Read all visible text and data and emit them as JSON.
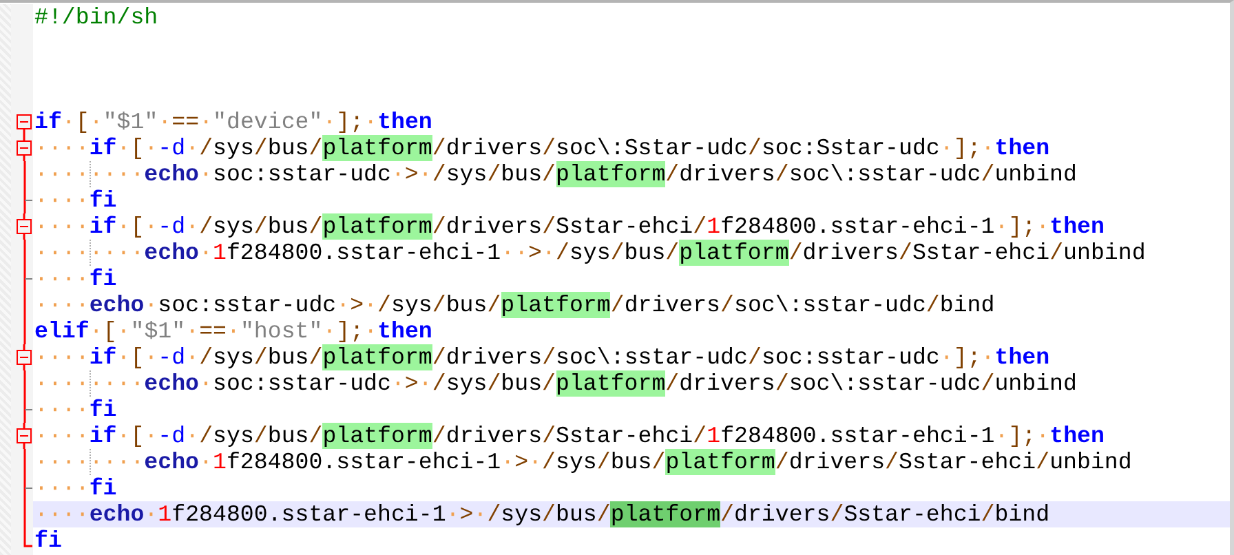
{
  "editor": {
    "lines": [
      {
        "fold_start": false,
        "fold_end": false,
        "active_fold": false,
        "current": false,
        "guide": false,
        "tokens": [
          {
            "kind": "comment",
            "text": "#!/bin/sh"
          }
        ]
      },
      {
        "fold_start": false,
        "fold_end": false,
        "active_fold": false,
        "current": false,
        "guide": false
      },
      {
        "fold_start": false,
        "fold_end": false,
        "active_fold": false,
        "current": false,
        "guide": false
      },
      {
        "fold_start": false,
        "fold_end": false,
        "active_fold": false,
        "current": false,
        "guide": false
      },
      {
        "fold_start": true,
        "fold_end": false,
        "active_fold": true,
        "current": false,
        "guide": false,
        "tokens": [
          {
            "kind": "keyword",
            "text": "if"
          },
          {
            "kind": "space",
            "text": "·"
          },
          {
            "kind": "operator",
            "text": "["
          },
          {
            "kind": "space",
            "text": "·"
          },
          {
            "kind": "string",
            "text": "\"$1\""
          },
          {
            "kind": "space",
            "text": "·"
          },
          {
            "kind": "operator",
            "text": "=="
          },
          {
            "kind": "space",
            "text": "·"
          },
          {
            "kind": "string",
            "text": "\"device\""
          },
          {
            "kind": "space",
            "text": "·"
          },
          {
            "kind": "operator",
            "text": "];"
          },
          {
            "kind": "space",
            "text": "·"
          },
          {
            "kind": "keyword",
            "text": "then"
          }
        ]
      },
      {
        "fold_start": true,
        "fold_end": false,
        "active_fold": true,
        "current": false,
        "guide": false,
        "tokens": [
          {
            "kind": "space",
            "text": "····"
          },
          {
            "kind": "keyword",
            "text": "if"
          },
          {
            "kind": "space",
            "text": "·"
          },
          {
            "kind": "operator",
            "text": "["
          },
          {
            "kind": "space",
            "text": "·"
          },
          {
            "kind": "option",
            "text": "-d"
          },
          {
            "kind": "space",
            "text": "·"
          },
          {
            "kind": "operator",
            "text": "/"
          },
          {
            "kind": "plain",
            "text": "sys"
          },
          {
            "kind": "operator",
            "text": "/"
          },
          {
            "kind": "plain",
            "text": "bus"
          },
          {
            "kind": "operator",
            "text": "/"
          },
          {
            "kind": "match",
            "text": "platform"
          },
          {
            "kind": "operator",
            "text": "/"
          },
          {
            "kind": "plain",
            "text": "drivers"
          },
          {
            "kind": "operator",
            "text": "/"
          },
          {
            "kind": "plain",
            "text": "soc\\:Sstar-udc"
          },
          {
            "kind": "operator",
            "text": "/"
          },
          {
            "kind": "plain",
            "text": "soc:Sstar-udc"
          },
          {
            "kind": "space",
            "text": "·"
          },
          {
            "kind": "operator",
            "text": "];"
          },
          {
            "kind": "space",
            "text": "·"
          },
          {
            "kind": "keyword",
            "text": "then"
          }
        ]
      },
      {
        "fold_start": false,
        "fold_end": false,
        "active_fold": true,
        "current": false,
        "guide": true,
        "tokens": [
          {
            "kind": "space",
            "text": "········"
          },
          {
            "kind": "builtin",
            "text": "echo"
          },
          {
            "kind": "space",
            "text": "·"
          },
          {
            "kind": "plain",
            "text": "soc:sstar-udc"
          },
          {
            "kind": "space",
            "text": "·"
          },
          {
            "kind": "operator",
            "text": ">"
          },
          {
            "kind": "space",
            "text": "·"
          },
          {
            "kind": "operator",
            "text": "/"
          },
          {
            "kind": "plain",
            "text": "sys"
          },
          {
            "kind": "operator",
            "text": "/"
          },
          {
            "kind": "plain",
            "text": "bus"
          },
          {
            "kind": "operator",
            "text": "/"
          },
          {
            "kind": "match",
            "text": "platform"
          },
          {
            "kind": "operator",
            "text": "/"
          },
          {
            "kind": "plain",
            "text": "drivers"
          },
          {
            "kind": "operator",
            "text": "/"
          },
          {
            "kind": "plain",
            "text": "soc\\:sstar-udc"
          },
          {
            "kind": "operator",
            "text": "/"
          },
          {
            "kind": "plain",
            "text": "unbind"
          }
        ]
      },
      {
        "fold_start": false,
        "fold_end": true,
        "active_fold": true,
        "current": false,
        "guide": false,
        "tokens": [
          {
            "kind": "space",
            "text": "····"
          },
          {
            "kind": "keyword",
            "text": "fi"
          }
        ]
      },
      {
        "fold_start": true,
        "fold_end": false,
        "active_fold": true,
        "current": false,
        "guide": false,
        "tokens": [
          {
            "kind": "space",
            "text": "····"
          },
          {
            "kind": "keyword",
            "text": "if"
          },
          {
            "kind": "space",
            "text": "·"
          },
          {
            "kind": "operator",
            "text": "["
          },
          {
            "kind": "space",
            "text": "·"
          },
          {
            "kind": "option",
            "text": "-d"
          },
          {
            "kind": "space",
            "text": "·"
          },
          {
            "kind": "operator",
            "text": "/"
          },
          {
            "kind": "plain",
            "text": "sys"
          },
          {
            "kind": "operator",
            "text": "/"
          },
          {
            "kind": "plain",
            "text": "bus"
          },
          {
            "kind": "operator",
            "text": "/"
          },
          {
            "kind": "match",
            "text": "platform"
          },
          {
            "kind": "operator",
            "text": "/"
          },
          {
            "kind": "plain",
            "text": "drivers"
          },
          {
            "kind": "operator",
            "text": "/"
          },
          {
            "kind": "plain",
            "text": "Sstar-ehci"
          },
          {
            "kind": "operator",
            "text": "/"
          },
          {
            "kind": "number",
            "text": "1"
          },
          {
            "kind": "plain",
            "text": "f284800.sstar-ehci-1"
          },
          {
            "kind": "space",
            "text": "·"
          },
          {
            "kind": "operator",
            "text": "];"
          },
          {
            "kind": "space",
            "text": "·"
          },
          {
            "kind": "keyword",
            "text": "then"
          }
        ]
      },
      {
        "fold_start": false,
        "fold_end": false,
        "active_fold": true,
        "current": false,
        "guide": true,
        "tokens": [
          {
            "kind": "space",
            "text": "········"
          },
          {
            "kind": "builtin",
            "text": "echo"
          },
          {
            "kind": "space",
            "text": "·"
          },
          {
            "kind": "number",
            "text": "1"
          },
          {
            "kind": "plain",
            "text": "f284800.sstar-ehci-1"
          },
          {
            "kind": "space",
            "text": "··"
          },
          {
            "kind": "operator",
            "text": ">"
          },
          {
            "kind": "space",
            "text": "·"
          },
          {
            "kind": "operator",
            "text": "/"
          },
          {
            "kind": "plain",
            "text": "sys"
          },
          {
            "kind": "operator",
            "text": "/"
          },
          {
            "kind": "plain",
            "text": "bus"
          },
          {
            "kind": "operator",
            "text": "/"
          },
          {
            "kind": "match",
            "text": "platform"
          },
          {
            "kind": "operator",
            "text": "/"
          },
          {
            "kind": "plain",
            "text": "drivers"
          },
          {
            "kind": "operator",
            "text": "/"
          },
          {
            "kind": "plain",
            "text": "Sstar-ehci"
          },
          {
            "kind": "operator",
            "text": "/"
          },
          {
            "kind": "plain",
            "text": "unbind"
          }
        ]
      },
      {
        "fold_start": false,
        "fold_end": true,
        "active_fold": true,
        "current": false,
        "guide": false,
        "tokens": [
          {
            "kind": "space",
            "text": "····"
          },
          {
            "kind": "keyword",
            "text": "fi"
          }
        ]
      },
      {
        "fold_start": false,
        "fold_end": false,
        "active_fold": true,
        "current": false,
        "guide": false,
        "tokens": [
          {
            "kind": "space",
            "text": "····"
          },
          {
            "kind": "builtin",
            "text": "echo"
          },
          {
            "kind": "space",
            "text": "·"
          },
          {
            "kind": "plain",
            "text": "soc:sstar-udc"
          },
          {
            "kind": "space",
            "text": "·"
          },
          {
            "kind": "operator",
            "text": ">"
          },
          {
            "kind": "space",
            "text": "·"
          },
          {
            "kind": "operator",
            "text": "/"
          },
          {
            "kind": "plain",
            "text": "sys"
          },
          {
            "kind": "operator",
            "text": "/"
          },
          {
            "kind": "plain",
            "text": "bus"
          },
          {
            "kind": "operator",
            "text": "/"
          },
          {
            "kind": "match",
            "text": "platform"
          },
          {
            "kind": "operator",
            "text": "/"
          },
          {
            "kind": "plain",
            "text": "drivers"
          },
          {
            "kind": "operator",
            "text": "/"
          },
          {
            "kind": "plain",
            "text": "soc\\:sstar-udc"
          },
          {
            "kind": "operator",
            "text": "/"
          },
          {
            "kind": "plain",
            "text": "bind"
          }
        ]
      },
      {
        "fold_start": false,
        "fold_end": false,
        "active_fold": true,
        "current": false,
        "guide": false,
        "tokens": [
          {
            "kind": "keyword",
            "text": "elif"
          },
          {
            "kind": "space",
            "text": "·"
          },
          {
            "kind": "operator",
            "text": "["
          },
          {
            "kind": "space",
            "text": "·"
          },
          {
            "kind": "string",
            "text": "\"$1\""
          },
          {
            "kind": "space",
            "text": "·"
          },
          {
            "kind": "operator",
            "text": "=="
          },
          {
            "kind": "space",
            "text": "·"
          },
          {
            "kind": "string",
            "text": "\"host\""
          },
          {
            "kind": "space",
            "text": "·"
          },
          {
            "kind": "operator",
            "text": "];"
          },
          {
            "kind": "space",
            "text": "·"
          },
          {
            "kind": "keyword",
            "text": "then"
          }
        ]
      },
      {
        "fold_start": true,
        "fold_end": false,
        "active_fold": true,
        "current": false,
        "guide": false,
        "tokens": [
          {
            "kind": "space",
            "text": "····"
          },
          {
            "kind": "keyword",
            "text": "if"
          },
          {
            "kind": "space",
            "text": "·"
          },
          {
            "kind": "operator",
            "text": "["
          },
          {
            "kind": "space",
            "text": "·"
          },
          {
            "kind": "option",
            "text": "-d"
          },
          {
            "kind": "space",
            "text": "·"
          },
          {
            "kind": "operator",
            "text": "/"
          },
          {
            "kind": "plain",
            "text": "sys"
          },
          {
            "kind": "operator",
            "text": "/"
          },
          {
            "kind": "plain",
            "text": "bus"
          },
          {
            "kind": "operator",
            "text": "/"
          },
          {
            "kind": "match",
            "text": "platform"
          },
          {
            "kind": "operator",
            "text": "/"
          },
          {
            "kind": "plain",
            "text": "drivers"
          },
          {
            "kind": "operator",
            "text": "/"
          },
          {
            "kind": "plain",
            "text": "soc\\:sstar-udc"
          },
          {
            "kind": "operator",
            "text": "/"
          },
          {
            "kind": "plain",
            "text": "soc:sstar-udc"
          },
          {
            "kind": "space",
            "text": "·"
          },
          {
            "kind": "operator",
            "text": "];"
          },
          {
            "kind": "space",
            "text": "·"
          },
          {
            "kind": "keyword",
            "text": "then"
          }
        ]
      },
      {
        "fold_start": false,
        "fold_end": false,
        "active_fold": true,
        "current": false,
        "guide": true,
        "tokens": [
          {
            "kind": "space",
            "text": "········"
          },
          {
            "kind": "builtin",
            "text": "echo"
          },
          {
            "kind": "space",
            "text": "·"
          },
          {
            "kind": "plain",
            "text": "soc:sstar-udc"
          },
          {
            "kind": "space",
            "text": "·"
          },
          {
            "kind": "operator",
            "text": ">"
          },
          {
            "kind": "space",
            "text": "·"
          },
          {
            "kind": "operator",
            "text": "/"
          },
          {
            "kind": "plain",
            "text": "sys"
          },
          {
            "kind": "operator",
            "text": "/"
          },
          {
            "kind": "plain",
            "text": "bus"
          },
          {
            "kind": "operator",
            "text": "/"
          },
          {
            "kind": "match",
            "text": "platform"
          },
          {
            "kind": "operator",
            "text": "/"
          },
          {
            "kind": "plain",
            "text": "drivers"
          },
          {
            "kind": "operator",
            "text": "/"
          },
          {
            "kind": "plain",
            "text": "soc\\:sstar-udc"
          },
          {
            "kind": "operator",
            "text": "/"
          },
          {
            "kind": "plain",
            "text": "unbind"
          }
        ]
      },
      {
        "fold_start": false,
        "fold_end": true,
        "active_fold": true,
        "current": false,
        "guide": false,
        "tokens": [
          {
            "kind": "space",
            "text": "····"
          },
          {
            "kind": "keyword",
            "text": "fi"
          }
        ]
      },
      {
        "fold_start": true,
        "fold_end": false,
        "active_fold": true,
        "current": false,
        "guide": false,
        "tokens": [
          {
            "kind": "space",
            "text": "····"
          },
          {
            "kind": "keyword",
            "text": "if"
          },
          {
            "kind": "space",
            "text": "·"
          },
          {
            "kind": "operator",
            "text": "["
          },
          {
            "kind": "space",
            "text": "·"
          },
          {
            "kind": "option",
            "text": "-d"
          },
          {
            "kind": "space",
            "text": "·"
          },
          {
            "kind": "operator",
            "text": "/"
          },
          {
            "kind": "plain",
            "text": "sys"
          },
          {
            "kind": "operator",
            "text": "/"
          },
          {
            "kind": "plain",
            "text": "bus"
          },
          {
            "kind": "operator",
            "text": "/"
          },
          {
            "kind": "match",
            "text": "platform"
          },
          {
            "kind": "operator",
            "text": "/"
          },
          {
            "kind": "plain",
            "text": "drivers"
          },
          {
            "kind": "operator",
            "text": "/"
          },
          {
            "kind": "plain",
            "text": "Sstar-ehci"
          },
          {
            "kind": "operator",
            "text": "/"
          },
          {
            "kind": "number",
            "text": "1"
          },
          {
            "kind": "plain",
            "text": "f284800.sstar-ehci-1"
          },
          {
            "kind": "space",
            "text": "·"
          },
          {
            "kind": "operator",
            "text": "];"
          },
          {
            "kind": "space",
            "text": "·"
          },
          {
            "kind": "keyword",
            "text": "then"
          }
        ]
      },
      {
        "fold_start": false,
        "fold_end": false,
        "active_fold": true,
        "current": false,
        "guide": true,
        "tokens": [
          {
            "kind": "space",
            "text": "········"
          },
          {
            "kind": "builtin",
            "text": "echo"
          },
          {
            "kind": "space",
            "text": "·"
          },
          {
            "kind": "number",
            "text": "1"
          },
          {
            "kind": "plain",
            "text": "f284800.sstar-ehci-1"
          },
          {
            "kind": "space",
            "text": "·"
          },
          {
            "kind": "operator",
            "text": ">"
          },
          {
            "kind": "space",
            "text": "·"
          },
          {
            "kind": "operator",
            "text": "/"
          },
          {
            "kind": "plain",
            "text": "sys"
          },
          {
            "kind": "operator",
            "text": "/"
          },
          {
            "kind": "plain",
            "text": "bus"
          },
          {
            "kind": "operator",
            "text": "/"
          },
          {
            "kind": "match",
            "text": "platform"
          },
          {
            "kind": "operator",
            "text": "/"
          },
          {
            "kind": "plain",
            "text": "drivers"
          },
          {
            "kind": "operator",
            "text": "/"
          },
          {
            "kind": "plain",
            "text": "Sstar-ehci"
          },
          {
            "kind": "operator",
            "text": "/"
          },
          {
            "kind": "plain",
            "text": "unbind"
          }
        ]
      },
      {
        "fold_start": false,
        "fold_end": true,
        "active_fold": true,
        "current": false,
        "guide": false,
        "tokens": [
          {
            "kind": "space",
            "text": "····"
          },
          {
            "kind": "keyword",
            "text": "fi"
          }
        ]
      },
      {
        "fold_start": false,
        "fold_end": false,
        "active_fold": true,
        "current": true,
        "guide": false,
        "tokens": [
          {
            "kind": "space",
            "text": "····"
          },
          {
            "kind": "builtin",
            "text": "echo"
          },
          {
            "kind": "space",
            "text": "·"
          },
          {
            "kind": "number",
            "text": "1"
          },
          {
            "kind": "plain",
            "text": "f284800.sstar-ehci-1"
          },
          {
            "kind": "space",
            "text": "·"
          },
          {
            "kind": "operator",
            "text": ">"
          },
          {
            "kind": "space",
            "text": "·"
          },
          {
            "kind": "operator",
            "text": "/"
          },
          {
            "kind": "plain",
            "text": "sys"
          },
          {
            "kind": "operator",
            "text": "/"
          },
          {
            "kind": "plain",
            "text": "bus"
          },
          {
            "kind": "operator",
            "text": "/"
          },
          {
            "kind": "match",
            "text": "platform"
          },
          {
            "kind": "operator",
            "text": "/"
          },
          {
            "kind": "plain",
            "text": "drivers"
          },
          {
            "kind": "operator",
            "text": "/"
          },
          {
            "kind": "plain",
            "text": "Sstar-ehci"
          },
          {
            "kind": "operator",
            "text": "/"
          },
          {
            "kind": "plain",
            "text": "bind"
          }
        ]
      },
      {
        "fold_start": false,
        "fold_end": true,
        "active_fold": true,
        "current": false,
        "guide": false,
        "tokens": [
          {
            "kind": "keyword",
            "text": "fi"
          }
        ]
      }
    ]
  }
}
